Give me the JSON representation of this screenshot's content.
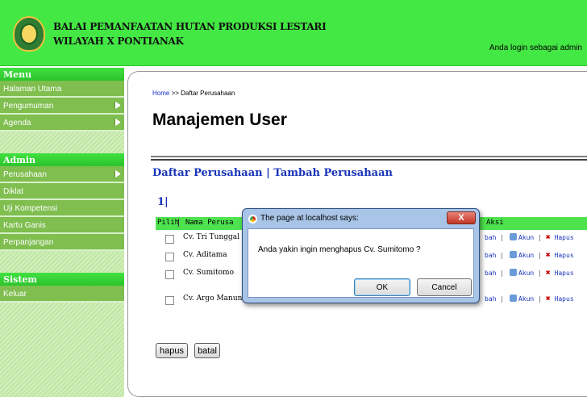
{
  "header": {
    "org_line1": "BALAI PEMANFAATAN HUTAN PRODUKSI LESTARI",
    "org_line2": "WILAYAH X PONTIANAK",
    "login_text": "Anda login sebagai admin"
  },
  "sidebar": {
    "sections": [
      {
        "title": "Menu",
        "items": [
          "Halaman Utama",
          "Pengumuman",
          "Agenda"
        ]
      },
      {
        "title": "Admin",
        "items": [
          "Perusahaan",
          "Diklat",
          "Uji Kompetensi",
          "Kartu Ganis",
          "Perpanjangan"
        ]
      },
      {
        "title": "Sistem",
        "items": [
          "Keluar"
        ]
      }
    ]
  },
  "breadcrumb": {
    "home": "Home",
    "separator": ">>",
    "current": "Daftar Perusahaan"
  },
  "page_title": "Manajemen User",
  "subnav": {
    "list_link": "Daftar Perusahaan",
    "divider": "|",
    "add_link": "Tambah Perusahaan"
  },
  "pager": "1|",
  "table": {
    "headers": {
      "select": "Pilih",
      "name": "Nama Perusa",
      "action": "Aksi"
    },
    "rows": [
      {
        "name": "Cv. Tri Tunggal"
      },
      {
        "name": "Cv. Aditama"
      },
      {
        "name": "Cv. Sumitomo"
      },
      {
        "name": "Cv. Argo Manungga"
      }
    ],
    "actions": {
      "edit": "bah",
      "account": "Akun",
      "delete": "Hapus",
      "sep": "|"
    }
  },
  "buttons": {
    "delete": "hapus",
    "cancel": "batal"
  },
  "dialog": {
    "title": "The page at localhost says:",
    "close": "X",
    "message": "Anda yakin ingin menghapus Cv. Sumitomo ?",
    "ok": "OK",
    "cancel": "Cancel"
  }
}
